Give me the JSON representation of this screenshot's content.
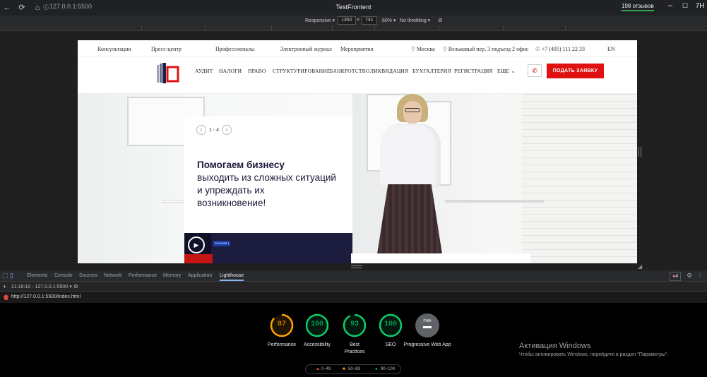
{
  "browser": {
    "address": "127.0.0.1:5500",
    "window_title": "TestFrontent",
    "reviews": "198 отзывов",
    "avatar": "7Н"
  },
  "device_toolbar": {
    "mode": "Responsive ▾",
    "width": "1350",
    "times": "×",
    "height": "741",
    "zoom": "60% ▾",
    "throttling": "No throttling ▾"
  },
  "site": {
    "topline": {
      "links": [
        "Консультации",
        "Пресс-центр",
        "Профессионалы",
        "Электронный журнал",
        "Мероприятия"
      ],
      "city": "Москва",
      "address": "Вельковый пер. 3 подъезд 2 офис",
      "phone": "+7 (495) 111 22 33",
      "lang": "EN"
    },
    "nav": {
      "items": [
        "АУДИТ",
        "НАЛОГИ",
        "ПРАВО",
        "СТРУКТУРИРОВАНИЕ",
        "БАНКРОТСТВО",
        "ЛИКВИДАЦИЯ",
        "БУХГАЛТЕРИЯ",
        "РЕГИСТРАЦИЯ",
        "ЕЩЕ"
      ],
      "cta": "ПОДАТЬ ЗАЯВКУ"
    },
    "hero": {
      "slide_counter": "1 - 4",
      "title_bold": "Помогаем бизнесу",
      "title_rest_1": "выходить из сложных ситуаций",
      "title_rest_2": "и упреждать их",
      "title_rest_3": "возникновение!",
      "tv_badge": "РОССИЯ 1"
    }
  },
  "devtools": {
    "tabs": [
      "Elements",
      "Console",
      "Sources",
      "Network",
      "Performance",
      "Memory",
      "Application",
      "Lighthouse"
    ],
    "active_tab": "Lighthouse",
    "error_count": "4",
    "report_selector": "21:16:10 - 127.0.0.1:5500 ▾",
    "report_url": "http://127.0.0.1:5500/index.html",
    "scores": [
      {
        "value": 87,
        "label": "Performance",
        "color": "#ffa400"
      },
      {
        "value": 100,
        "label": "Accessibility",
        "color": "#0cce6b"
      },
      {
        "value": 93,
        "label": "Best Practices",
        "color": "#0cce6b"
      },
      {
        "value": 100,
        "label": "SEO",
        "color": "#0cce6b"
      }
    ],
    "pwa": {
      "badge": "PWA",
      "label": "Progressive Web App"
    },
    "legend": {
      "low": "0–49",
      "mid": "50–89",
      "high": "90–100"
    }
  },
  "windows_activation": {
    "title": "Активация Windows",
    "subtitle": "Чтобы активировать Windows, перейдите в раздел \"Параметры\"."
  }
}
